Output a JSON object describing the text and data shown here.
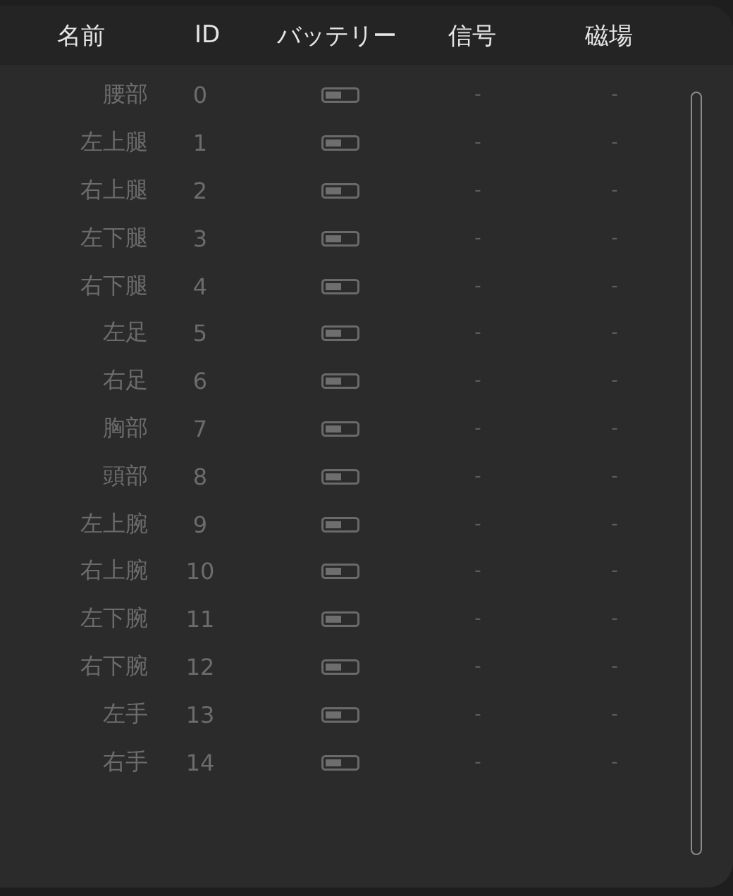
{
  "table": {
    "columns": [
      "名前",
      "ID",
      "バッテリー",
      "信号",
      "磁場"
    ],
    "rows": [
      {
        "name": "腰部",
        "id": "0",
        "signal": "-",
        "magnetic": "-"
      },
      {
        "name": "左上腿",
        "id": "1",
        "signal": "-",
        "magnetic": "-"
      },
      {
        "name": "右上腿",
        "id": "2",
        "signal": "-",
        "magnetic": "-"
      },
      {
        "name": "左下腿",
        "id": "3",
        "signal": "-",
        "magnetic": "-"
      },
      {
        "name": "右下腿",
        "id": "4",
        "signal": "-",
        "magnetic": "-"
      },
      {
        "name": "左足",
        "id": "5",
        "signal": "-",
        "magnetic": "-"
      },
      {
        "name": "右足",
        "id": "6",
        "signal": "-",
        "magnetic": "-"
      },
      {
        "name": "胸部",
        "id": "7",
        "signal": "-",
        "magnetic": "-"
      },
      {
        "name": "頭部",
        "id": "8",
        "signal": "-",
        "magnetic": "-"
      },
      {
        "name": "左上腕",
        "id": "9",
        "signal": "-",
        "magnetic": "-"
      },
      {
        "name": "右上腕",
        "id": "10",
        "signal": "-",
        "magnetic": "-"
      },
      {
        "name": "左下腕",
        "id": "11",
        "signal": "-",
        "magnetic": "-"
      },
      {
        "name": "右下腕",
        "id": "12",
        "signal": "-",
        "magnetic": "-"
      },
      {
        "name": "左手",
        "id": "13",
        "signal": "-",
        "magnetic": "-"
      },
      {
        "name": "右手",
        "id": "14",
        "signal": "-",
        "magnetic": "-"
      }
    ]
  }
}
